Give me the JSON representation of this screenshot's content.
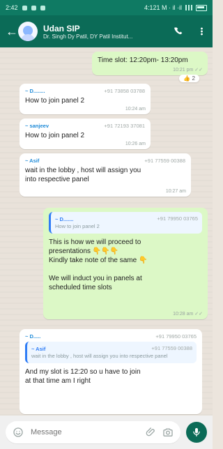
{
  "status": {
    "time": "2:42",
    "right": "4:121 M · il ·il"
  },
  "header": {
    "title": "Udan SIP",
    "subtitle": "Dr. Singh Dy Patil, DY Patil Institut..."
  },
  "messages": [
    {
      "type": "out",
      "text": "Time slot: 12:20pm- 13:20pm",
      "time": "10:21 pm ✓✓",
      "reaction": "👍 2"
    },
    {
      "type": "in",
      "sender": "~ D........",
      "phone": "+91 73858 03788",
      "text": "How to join panel 2",
      "time": "10:24 am"
    },
    {
      "type": "in",
      "sender": "~ sanjeev",
      "phone": "+91 72193 37081",
      "text": "How to join panel 2",
      "time": "10:26 am"
    },
    {
      "type": "in",
      "sender": "~ Asif",
      "phone": "+91 77559 00388",
      "text": "wait in the lobby , host will assign you\ninto respective panel",
      "time": "10:27 am"
    },
    {
      "type": "out",
      "quote": {
        "name": "~ D.......",
        "phone": "+91 79950 03765",
        "text": "How to join panel 2"
      },
      "text": "This is how we will proceed to\npresentations 👇👇👇\nKindly take note of the same 👇\n\nWe will induct you in panels at\nscheduled time slots",
      "time": "10:28 am ✓✓"
    },
    {
      "type": "in",
      "sender": "~ D.....",
      "phone": "+91 79950 03765",
      "quote": {
        "name": "~ Asif",
        "phone": "+91 77559 00388",
        "text": "wait in the lobby , host will assign you into\nrespective panel"
      },
      "text": "And my slot is 12:20 so u have to join\nat that time am I right",
      "time": ""
    }
  ],
  "composer": {
    "placeholder": "Message"
  },
  "icons": {
    "back": "back-arrow-icon",
    "call": "call-icon",
    "menu": "menu-icon",
    "emoji": "emoji-icon",
    "attach": "attach-icon",
    "camera": "camera-icon",
    "mic": "mic-icon"
  },
  "colors": {
    "header": "#0b6b57",
    "status": "#0f7a63",
    "outgoing": "#dcf8c6",
    "incoming": "#ffffff"
  }
}
